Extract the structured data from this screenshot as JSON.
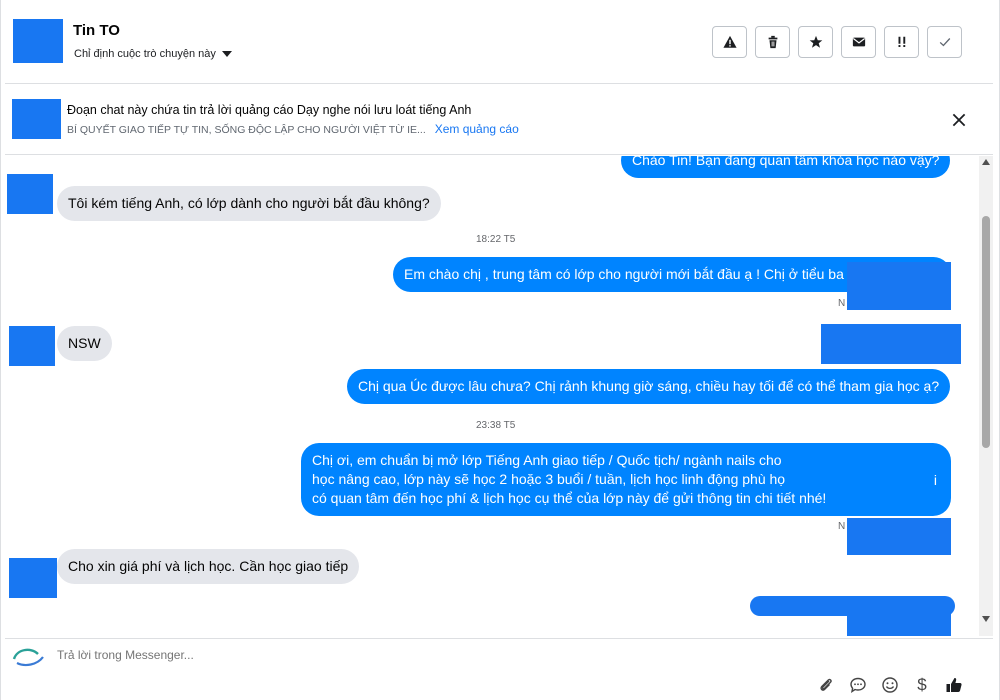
{
  "header": {
    "contact_name": "Tin TO",
    "assign_label": "Chỉ định cuộc trò chuyện này",
    "actions": [
      "warning-icon",
      "trash-icon",
      "star-icon",
      "envelope-icon",
      "important-icon",
      "check-icon"
    ]
  },
  "ad_banner": {
    "title": "Đoạn chat này chứa tin trả lời quảng cáo Dạy nghe nói lưu loát tiếng Anh",
    "subtitle": "BÍ QUYẾT GIAO TIẾP TỰ TIN, SỐNG ĐỘC LẬP CHO NGƯỜI VIỆT TỪ IE...",
    "link_text": "Xem quảng cáo"
  },
  "messages": {
    "m0": "Chào Tin! Bạn đang quan tâm khóa học nào vậy?",
    "m1": "Tôi kém tiếng Anh, có lớp dành cho người bắt đầu không?",
    "ts1": "18:22 T5",
    "m2": "Em chào chị , trung tâm có lớp cho người mới bắt đầu ạ ! Chị ở tiểu ba",
    "seen1": "N",
    "m3": "NSW",
    "m4": "Chị qua Úc được lâu chưa? Chị rảnh khung giờ sáng, chiều hay tối để có thể tham gia học ạ?",
    "ts2": "23:38 T5",
    "m5_line1": "Chị ơi, em chuẩn bị mở lớp Tiếng Anh giao tiếp / Quốc tịch/ ngành nails cho",
    "m5_line2": "học nâng cao, lớp này sẽ học 2 hoặc 3 buổi / tuần, lịch học linh động phù họ",
    "m5_line3": "có quan tâm đến học phí & lịch học cụ thể của lớp này để gửi thông tin chi tiết nhé!",
    "m5_tail": "i",
    "seen2": "N",
    "m6": "Cho xin giá phí và lịch học. Cần học giao tiếp"
  },
  "composer": {
    "placeholder": "Trả lời trong Messenger..."
  },
  "colors": {
    "brand": "#1877f2",
    "outgoing": "#0084ff",
    "incoming": "#e4e6eb"
  }
}
